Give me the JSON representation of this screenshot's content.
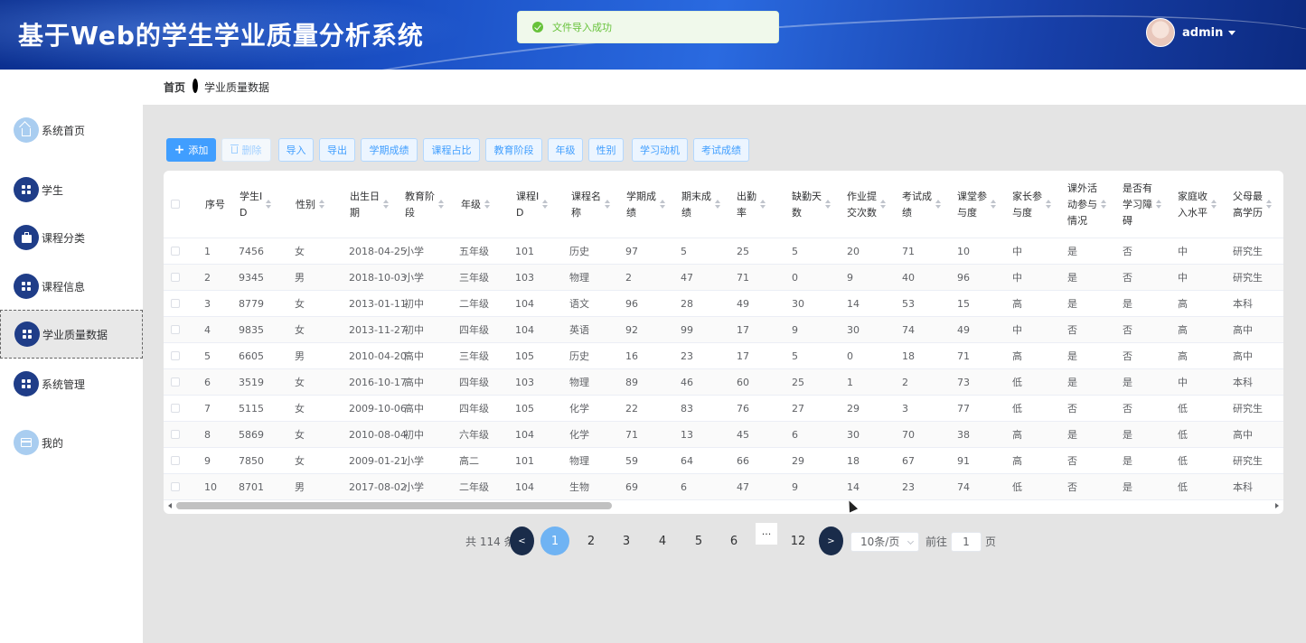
{
  "app": {
    "title": "基于Web的学生学业质量分析系统",
    "user": "admin"
  },
  "toast": {
    "message": "文件导入成功"
  },
  "sidebar": {
    "items": [
      {
        "label": "系统首页",
        "icon": "home-icon"
      },
      {
        "label": "学生",
        "icon": "grid-icon"
      },
      {
        "label": "课程分类",
        "icon": "briefcase-icon"
      },
      {
        "label": "课程信息",
        "icon": "grid-icon"
      },
      {
        "label": "学业质量数据",
        "icon": "grid-icon",
        "active": true
      },
      {
        "label": "系统管理",
        "icon": "grid-icon"
      },
      {
        "label": "我的",
        "icon": "card-icon"
      }
    ]
  },
  "breadcrumb": {
    "home": "首页",
    "current": "学业质量数据"
  },
  "toolbar": {
    "add": "添加",
    "delete": "删除",
    "import": "导入",
    "export": "导出",
    "term_score": "学期成绩",
    "course_ratio": "课程占比",
    "edu_stage": "教育阶段",
    "grade": "年级",
    "gender": "性别",
    "motivation": "学习动机",
    "exam_score": "考试成绩"
  },
  "table": {
    "headers": [
      [
        "序号"
      ],
      [
        "学生I",
        "D"
      ],
      [
        "性别"
      ],
      [
        "出生日",
        "期"
      ],
      [
        "教育阶",
        "段"
      ],
      [
        "年级"
      ],
      [
        "课程I",
        "D"
      ],
      [
        "课程名",
        "称"
      ],
      [
        "学期成",
        "绩"
      ],
      [
        "期末成",
        "绩"
      ],
      [
        "出勤",
        "率"
      ],
      [
        "缺勤天",
        "数"
      ],
      [
        "作业提",
        "交次数"
      ],
      [
        "考试成",
        "绩"
      ],
      [
        "课堂参",
        "与度"
      ],
      [
        "家长参",
        "与度"
      ],
      [
        "课外活",
        "动参与",
        "情况"
      ],
      [
        "是否有",
        "学习障",
        "碍"
      ],
      [
        "家庭收",
        "入水平"
      ],
      [
        "父母最",
        "高学历"
      ]
    ],
    "rows": [
      [
        "1",
        "7456",
        "女",
        "2018-04-25",
        "小学",
        "五年级",
        "101",
        "历史",
        "97",
        "5",
        "25",
        "5",
        "20",
        "71",
        "10",
        "中",
        "是",
        "否",
        "中",
        "研究生"
      ],
      [
        "2",
        "9345",
        "男",
        "2018-10-03",
        "小学",
        "三年级",
        "103",
        "物理",
        "2",
        "47",
        "71",
        "0",
        "9",
        "40",
        "96",
        "中",
        "是",
        "否",
        "中",
        "研究生"
      ],
      [
        "3",
        "8779",
        "女",
        "2013-01-11",
        "初中",
        "二年级",
        "104",
        "语文",
        "96",
        "28",
        "49",
        "30",
        "14",
        "53",
        "15",
        "高",
        "是",
        "是",
        "高",
        "本科"
      ],
      [
        "4",
        "9835",
        "女",
        "2013-11-27",
        "初中",
        "四年级",
        "104",
        "英语",
        "92",
        "99",
        "17",
        "9",
        "30",
        "74",
        "49",
        "中",
        "否",
        "否",
        "高",
        "高中"
      ],
      [
        "5",
        "6605",
        "男",
        "2010-04-20",
        "高中",
        "三年级",
        "105",
        "历史",
        "16",
        "23",
        "17",
        "5",
        "0",
        "18",
        "71",
        "高",
        "是",
        "否",
        "高",
        "高中"
      ],
      [
        "6",
        "3519",
        "女",
        "2016-10-17",
        "高中",
        "四年级",
        "103",
        "物理",
        "89",
        "46",
        "60",
        "25",
        "1",
        "2",
        "73",
        "低",
        "是",
        "是",
        "中",
        "本科"
      ],
      [
        "7",
        "5115",
        "女",
        "2009-10-06",
        "高中",
        "四年级",
        "105",
        "化学",
        "22",
        "83",
        "76",
        "27",
        "29",
        "3",
        "77",
        "低",
        "否",
        "否",
        "低",
        "研究生"
      ],
      [
        "8",
        "5869",
        "女",
        "2010-08-04",
        "初中",
        "六年级",
        "104",
        "化学",
        "71",
        "13",
        "45",
        "6",
        "30",
        "70",
        "38",
        "高",
        "是",
        "是",
        "低",
        "高中"
      ],
      [
        "9",
        "7850",
        "女",
        "2009-01-21",
        "小学",
        "高二",
        "101",
        "物理",
        "59",
        "64",
        "66",
        "29",
        "18",
        "67",
        "91",
        "高",
        "否",
        "是",
        "低",
        "研究生"
      ],
      [
        "10",
        "8701",
        "男",
        "2017-08-02",
        "小学",
        "二年级",
        "104",
        "生物",
        "69",
        "6",
        "47",
        "9",
        "14",
        "23",
        "74",
        "低",
        "否",
        "是",
        "低",
        "本科"
      ]
    ]
  },
  "pagination": {
    "total": "共 114 条",
    "prev": "<",
    "next": ">",
    "pages": [
      "1",
      "2",
      "3",
      "4",
      "5",
      "6"
    ],
    "more": "···",
    "last": "12",
    "page_size": "10条/页",
    "goto_label": "前往",
    "goto_value": "1",
    "page_suffix": "页"
  }
}
